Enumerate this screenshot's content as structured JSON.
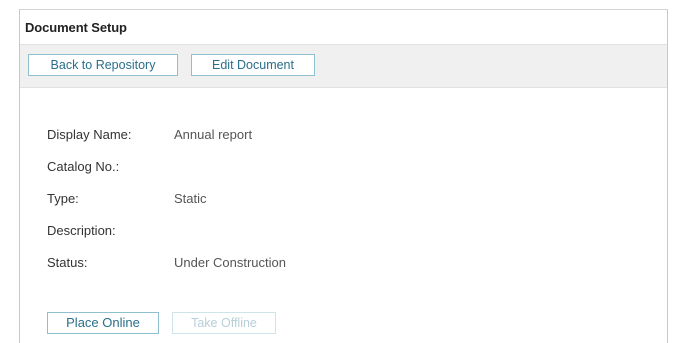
{
  "panel": {
    "title": "Document Setup"
  },
  "toolbar": {
    "back_label": "Back to Repository",
    "edit_label": "Edit Document"
  },
  "fields": [
    {
      "label": "Display Name:",
      "value": "Annual report"
    },
    {
      "label": "Catalog No.:",
      "value": ""
    },
    {
      "label": "Type:",
      "value": "Static"
    },
    {
      "label": "Description:",
      "value": ""
    },
    {
      "label": "Status:",
      "value": "Under Construction"
    }
  ],
  "actions": {
    "place_online_label": "Place Online",
    "take_offline_label": "Take Offline",
    "take_offline_state": "disabled"
  },
  "colors": {
    "button_text": "#2a6f8a",
    "button_border": "#8fbfd0",
    "toolbar_bg": "#f0f0f0",
    "disabled_text": "#b7cfd8"
  }
}
